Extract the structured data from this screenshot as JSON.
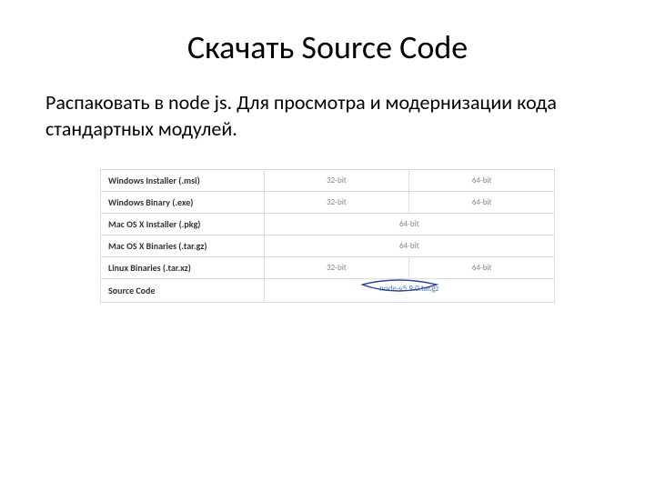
{
  "title": "Скачать Source Code",
  "subtitle": "Распаковать в node js. Для просмотра и модернизации кода стандартных модулей.",
  "table": {
    "rows": [
      {
        "label": "Windows Installer (.msi)",
        "cells": [
          "32-bit",
          "64-bit"
        ]
      },
      {
        "label": "Windows Binary (.exe)",
        "cells": [
          "32-bit",
          "64-bit"
        ]
      },
      {
        "label": "Mac OS X Installer (.pkg)",
        "cells": [
          "64-bit"
        ]
      },
      {
        "label": "Mac OS X Binaries (.tar.gz)",
        "cells": [
          "64-bit"
        ]
      },
      {
        "label": "Linux Binaries (.tar.xz)",
        "cells": [
          "32-bit",
          "64-bit"
        ]
      },
      {
        "label": "Source Code",
        "cells": [
          "node-v5.9.0.tar.gz"
        ],
        "link": true
      }
    ]
  }
}
